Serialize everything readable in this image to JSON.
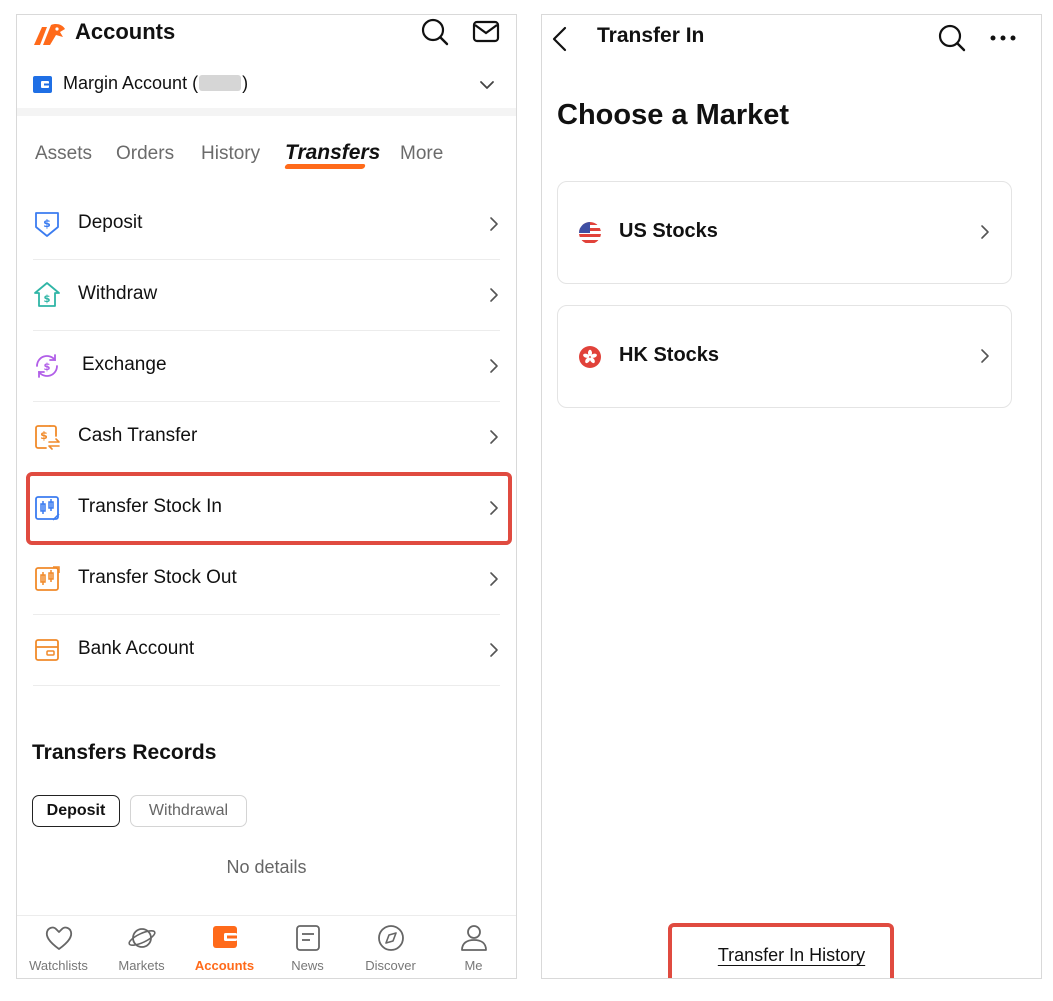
{
  "left": {
    "app_title": "Accounts",
    "account": {
      "prefix": "Margin Account (",
      "suffix": ")"
    },
    "tabs": [
      {
        "label": "Assets",
        "active": false
      },
      {
        "label": "Orders",
        "active": false
      },
      {
        "label": "History",
        "active": false
      },
      {
        "label": "Transfers",
        "active": true
      },
      {
        "label": "More",
        "active": false
      }
    ],
    "menu": [
      {
        "label": "Deposit",
        "icon": "deposit-icon",
        "color": "#3b7cf0"
      },
      {
        "label": "Withdraw",
        "icon": "withdraw-icon",
        "color": "#2fb5a6"
      },
      {
        "label": "Exchange",
        "icon": "exchange-icon",
        "color": "#b15ee8"
      },
      {
        "label": "Cash Transfer",
        "icon": "cash-transfer-icon",
        "color": "#f08a2a"
      },
      {
        "label": "Transfer Stock In",
        "icon": "transfer-stock-in-icon",
        "color": "#3b7cf0"
      },
      {
        "label": "Transfer Stock Out",
        "icon": "transfer-stock-out-icon",
        "color": "#f08a2a"
      },
      {
        "label": "Bank Account",
        "icon": "bank-account-icon",
        "color": "#f08a2a"
      }
    ],
    "records": {
      "title": "Transfers Records",
      "filters": [
        "Deposit",
        "Withdrawal"
      ],
      "empty_text": "No details"
    },
    "nav": [
      {
        "label": "Watchlists",
        "icon": "heart-icon",
        "active": false
      },
      {
        "label": "Markets",
        "icon": "planet-icon",
        "active": false
      },
      {
        "label": "Accounts",
        "icon": "wallet-icon",
        "active": true
      },
      {
        "label": "News",
        "icon": "news-icon",
        "active": false
      },
      {
        "label": "Discover",
        "icon": "compass-icon",
        "active": false
      },
      {
        "label": "Me",
        "icon": "user-icon",
        "active": false
      }
    ]
  },
  "right": {
    "title": "Transfer In",
    "heading": "Choose a Market",
    "markets": [
      {
        "label": "US Stocks",
        "icon": "us-flag-icon"
      },
      {
        "label": "HK Stocks",
        "icon": "hk-flag-icon"
      }
    ],
    "history_link": "Transfer In History"
  },
  "colors": {
    "accent": "#ff6a1a",
    "highlight": "#e04b40",
    "brand_blue": "#1f6fe5"
  }
}
